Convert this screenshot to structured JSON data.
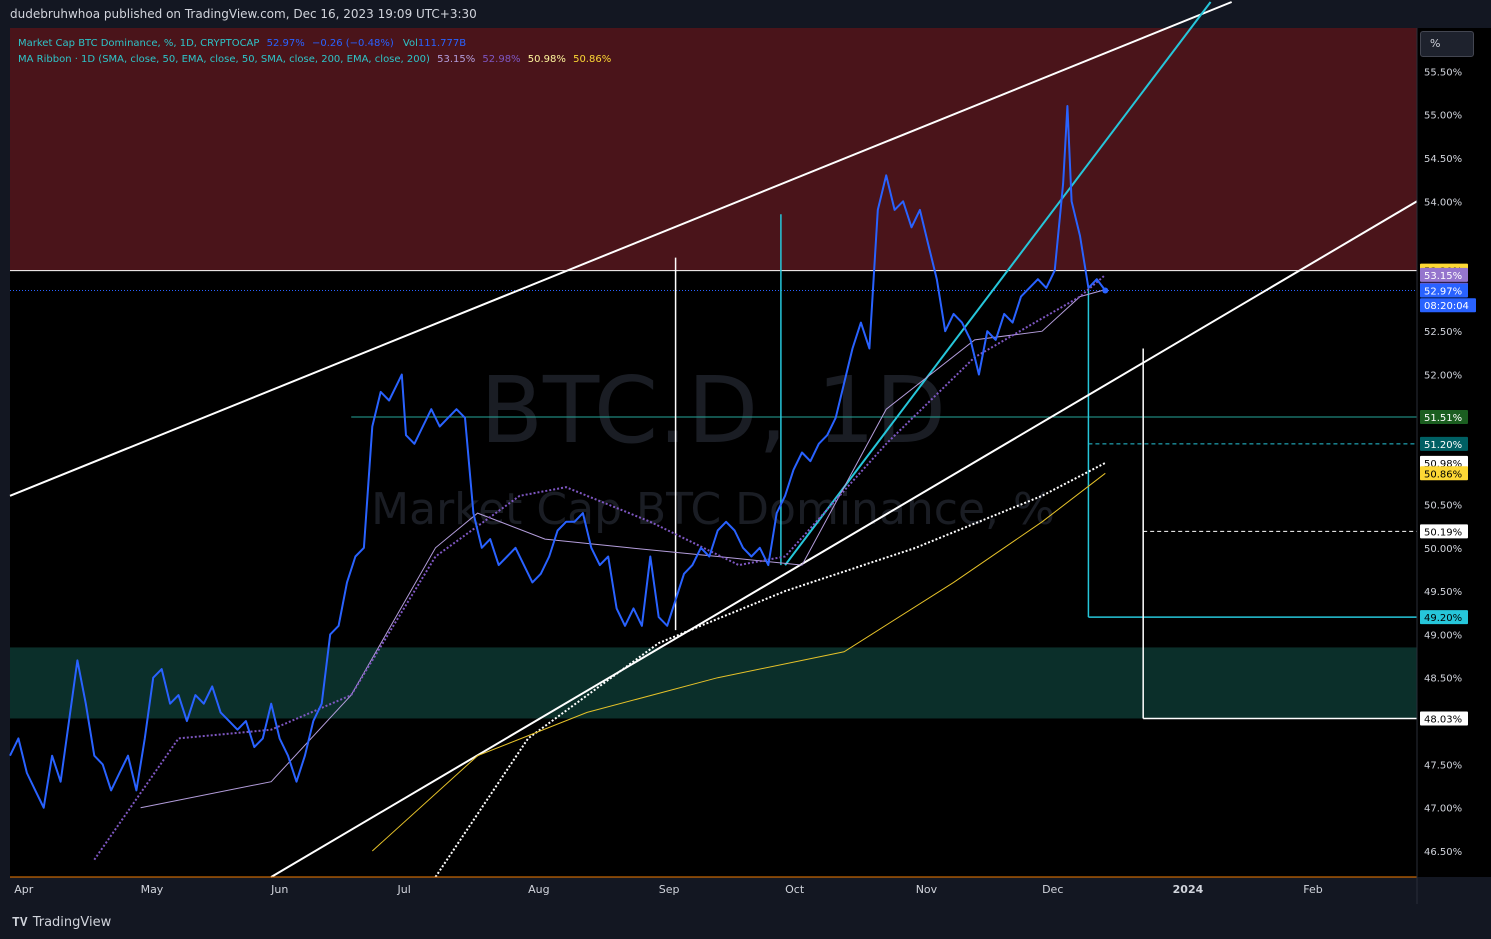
{
  "header": {
    "publisher": "dudebruhwhoa published on TradingView.com, Dec 16, 2023 19:09 UTC+3:30"
  },
  "legend": {
    "row1_name": "Market Cap BTC Dominance, %, 1D, CRYPTOCAP",
    "row1_value": "52.97%",
    "row1_change": "−0.26 (−0.48%)",
    "row1_vol_label": "Vol",
    "row1_vol_value": "111.777B",
    "row2_name": "MA Ribbon · 1D (SMA, close, 50, EMA, close, 50, SMA, close, 200, EMA, close, 200)",
    "row2_v1": "53.15%",
    "row2_v2": "52.98%",
    "row2_v3": "50.98%",
    "row2_v4": "50.86%"
  },
  "watermark": {
    "symbol": "BTC.D, 1D",
    "description": "Market Cap BTC Dominance, %"
  },
  "units_button": "%",
  "footer": {
    "brand": "TradingView"
  },
  "colors": {
    "background": "#000000",
    "resistance_zone": "#4a141a",
    "support_zone": "#0b2f2a",
    "price_line": "#2962ff",
    "sma50": "#b39ddb",
    "ema50": "#7e57c2",
    "sma200": "#ffffff",
    "ema200": "#e6c229",
    "trendline": "#ffffff",
    "cyan": "#26c6da"
  },
  "chart_data": {
    "type": "line",
    "symbol": "BTC.D",
    "interval": "1D",
    "x_range": [
      "2023-03-31",
      "2024-02-28"
    ],
    "ylim": [
      46.2,
      56.0
    ],
    "x_tick_labels": [
      {
        "label": "Apr",
        "date": "2023-04-01"
      },
      {
        "label": "May",
        "date": "2023-05-01"
      },
      {
        "label": "Jun",
        "date": "2023-06-01"
      },
      {
        "label": "Jul",
        "date": "2023-07-01"
      },
      {
        "label": "Aug",
        "date": "2023-08-01"
      },
      {
        "label": "Sep",
        "date": "2023-09-01"
      },
      {
        "label": "Oct",
        "date": "2023-10-01"
      },
      {
        "label": "Nov",
        "date": "2023-11-01"
      },
      {
        "label": "Dec",
        "date": "2023-12-01"
      },
      {
        "label": "2024",
        "date": "2024-01-01"
      },
      {
        "label": "Feb",
        "date": "2024-02-01"
      }
    ],
    "y_tick_labels": [
      "55.50%",
      "55.00%",
      "54.50%",
      "54.00%",
      "52.50%",
      "52.00%",
      "50.50%",
      "50.00%",
      "49.50%",
      "49.00%",
      "48.50%",
      "47.50%",
      "47.00%",
      "46.50%"
    ],
    "y_tick_values": [
      55.5,
      55.0,
      54.5,
      54.0,
      52.5,
      52.0,
      50.5,
      50.0,
      49.5,
      49.0,
      48.5,
      47.5,
      47.0,
      46.5
    ],
    "price_series": {
      "points": [
        [
          "2023-03-31",
          47.6
        ],
        [
          "2023-04-02",
          47.8
        ],
        [
          "2023-04-04",
          47.4
        ],
        [
          "2023-04-06",
          47.2
        ],
        [
          "2023-04-08",
          47.0
        ],
        [
          "2023-04-10",
          47.6
        ],
        [
          "2023-04-12",
          47.3
        ],
        [
          "2023-04-14",
          48.0
        ],
        [
          "2023-04-16",
          48.7
        ],
        [
          "2023-04-18",
          48.2
        ],
        [
          "2023-04-20",
          47.6
        ],
        [
          "2023-04-22",
          47.5
        ],
        [
          "2023-04-24",
          47.2
        ],
        [
          "2023-04-26",
          47.4
        ],
        [
          "2023-04-28",
          47.6
        ],
        [
          "2023-04-30",
          47.2
        ],
        [
          "2023-05-02",
          47.8
        ],
        [
          "2023-05-04",
          48.5
        ],
        [
          "2023-05-06",
          48.6
        ],
        [
          "2023-05-08",
          48.2
        ],
        [
          "2023-05-10",
          48.3
        ],
        [
          "2023-05-12",
          48.0
        ],
        [
          "2023-05-14",
          48.3
        ],
        [
          "2023-05-16",
          48.2
        ],
        [
          "2023-05-18",
          48.4
        ],
        [
          "2023-05-20",
          48.1
        ],
        [
          "2023-05-22",
          48.0
        ],
        [
          "2023-05-24",
          47.9
        ],
        [
          "2023-05-26",
          48.0
        ],
        [
          "2023-05-28",
          47.7
        ],
        [
          "2023-05-30",
          47.8
        ],
        [
          "2023-06-01",
          48.2
        ],
        [
          "2023-06-03",
          47.8
        ],
        [
          "2023-06-05",
          47.6
        ],
        [
          "2023-06-07",
          47.3
        ],
        [
          "2023-06-09",
          47.6
        ],
        [
          "2023-06-11",
          48.0
        ],
        [
          "2023-06-13",
          48.2
        ],
        [
          "2023-06-15",
          49.0
        ],
        [
          "2023-06-17",
          49.1
        ],
        [
          "2023-06-19",
          49.6
        ],
        [
          "2023-06-21",
          49.9
        ],
        [
          "2023-06-23",
          50.0
        ],
        [
          "2023-06-25",
          51.4
        ],
        [
          "2023-06-27",
          51.8
        ],
        [
          "2023-06-29",
          51.7
        ],
        [
          "2023-07-01",
          51.9
        ],
        [
          "2023-07-02",
          52.0
        ],
        [
          "2023-07-03",
          51.3
        ],
        [
          "2023-07-05",
          51.2
        ],
        [
          "2023-07-07",
          51.4
        ],
        [
          "2023-07-09",
          51.6
        ],
        [
          "2023-07-11",
          51.4
        ],
        [
          "2023-07-13",
          51.5
        ],
        [
          "2023-07-15",
          51.6
        ],
        [
          "2023-07-17",
          51.5
        ],
        [
          "2023-07-19",
          50.4
        ],
        [
          "2023-07-21",
          50.0
        ],
        [
          "2023-07-23",
          50.1
        ],
        [
          "2023-07-25",
          49.8
        ],
        [
          "2023-07-27",
          49.9
        ],
        [
          "2023-07-29",
          50.0
        ],
        [
          "2023-07-31",
          49.8
        ],
        [
          "2023-08-02",
          49.6
        ],
        [
          "2023-08-04",
          49.7
        ],
        [
          "2023-08-06",
          49.9
        ],
        [
          "2023-08-08",
          50.2
        ],
        [
          "2023-08-10",
          50.3
        ],
        [
          "2023-08-12",
          50.3
        ],
        [
          "2023-08-14",
          50.4
        ],
        [
          "2023-08-16",
          50.0
        ],
        [
          "2023-08-18",
          49.8
        ],
        [
          "2023-08-20",
          49.9
        ],
        [
          "2023-08-22",
          49.3
        ],
        [
          "2023-08-24",
          49.1
        ],
        [
          "2023-08-26",
          49.3
        ],
        [
          "2023-08-28",
          49.1
        ],
        [
          "2023-08-30",
          49.9
        ],
        [
          "2023-09-01",
          49.2
        ],
        [
          "2023-09-03",
          49.1
        ],
        [
          "2023-09-05",
          49.4
        ],
        [
          "2023-09-07",
          49.7
        ],
        [
          "2023-09-09",
          49.8
        ],
        [
          "2023-09-11",
          50.0
        ],
        [
          "2023-09-13",
          49.9
        ],
        [
          "2023-09-15",
          50.2
        ],
        [
          "2023-09-17",
          50.3
        ],
        [
          "2023-09-19",
          50.2
        ],
        [
          "2023-09-21",
          50.0
        ],
        [
          "2023-09-23",
          49.9
        ],
        [
          "2023-09-25",
          50.0
        ],
        [
          "2023-09-27",
          49.8
        ],
        [
          "2023-09-29",
          50.4
        ],
        [
          "2023-10-01",
          50.6
        ],
        [
          "2023-10-03",
          50.9
        ],
        [
          "2023-10-05",
          51.1
        ],
        [
          "2023-10-07",
          51.0
        ],
        [
          "2023-10-09",
          51.2
        ],
        [
          "2023-10-11",
          51.3
        ],
        [
          "2023-10-13",
          51.5
        ],
        [
          "2023-10-15",
          51.9
        ],
        [
          "2023-10-17",
          52.3
        ],
        [
          "2023-10-19",
          52.6
        ],
        [
          "2023-10-21",
          52.3
        ],
        [
          "2023-10-23",
          53.9
        ],
        [
          "2023-10-25",
          54.3
        ],
        [
          "2023-10-27",
          53.9
        ],
        [
          "2023-10-29",
          54.0
        ],
        [
          "2023-10-31",
          53.7
        ],
        [
          "2023-11-02",
          53.9
        ],
        [
          "2023-11-04",
          53.5
        ],
        [
          "2023-11-06",
          53.1
        ],
        [
          "2023-11-08",
          52.5
        ],
        [
          "2023-11-10",
          52.7
        ],
        [
          "2023-11-12",
          52.6
        ],
        [
          "2023-11-14",
          52.4
        ],
        [
          "2023-11-16",
          52.0
        ],
        [
          "2023-11-18",
          52.5
        ],
        [
          "2023-11-20",
          52.4
        ],
        [
          "2023-11-22",
          52.7
        ],
        [
          "2023-11-24",
          52.6
        ],
        [
          "2023-11-26",
          52.9
        ],
        [
          "2023-11-28",
          53.0
        ],
        [
          "2023-11-30",
          53.1
        ],
        [
          "2023-12-02",
          53.0
        ],
        [
          "2023-12-04",
          53.2
        ],
        [
          "2023-12-06",
          54.2
        ],
        [
          "2023-12-07",
          55.1
        ],
        [
          "2023-12-08",
          54.0
        ],
        [
          "2023-12-10",
          53.6
        ],
        [
          "2023-12-12",
          53.0
        ],
        [
          "2023-12-14",
          53.1
        ],
        [
          "2023-12-16",
          52.97
        ]
      ]
    },
    "ma_ribbon": [
      {
        "name": "SMA 50",
        "type": "SMA",
        "length": 50,
        "style": "solid",
        "color": "#b39ddb",
        "points": [
          [
            "2023-05-01",
            47.0
          ],
          [
            "2023-06-01",
            47.3
          ],
          [
            "2023-06-20",
            48.3
          ],
          [
            "2023-07-10",
            50.0
          ],
          [
            "2023-07-20",
            50.4
          ],
          [
            "2023-08-05",
            50.1
          ],
          [
            "2023-08-25",
            50.0
          ],
          [
            "2023-09-15",
            49.9
          ],
          [
            "2023-10-05",
            49.8
          ],
          [
            "2023-10-25",
            51.6
          ],
          [
            "2023-11-15",
            52.4
          ],
          [
            "2023-12-01",
            52.5
          ],
          [
            "2023-12-10",
            52.9
          ],
          [
            "2023-12-16",
            52.98
          ]
        ]
      },
      {
        "name": "EMA 50",
        "type": "EMA",
        "length": 50,
        "style": "dotted",
        "color": "#7e57c2",
        "points": [
          [
            "2023-04-20",
            46.4
          ],
          [
            "2023-05-10",
            47.8
          ],
          [
            "2023-06-01",
            47.9
          ],
          [
            "2023-06-20",
            48.3
          ],
          [
            "2023-07-10",
            49.9
          ],
          [
            "2023-07-30",
            50.6
          ],
          [
            "2023-08-10",
            50.7
          ],
          [
            "2023-08-30",
            50.3
          ],
          [
            "2023-09-20",
            49.8
          ],
          [
            "2023-10-01",
            49.9
          ],
          [
            "2023-10-25",
            51.2
          ],
          [
            "2023-11-15",
            52.2
          ],
          [
            "2023-12-10",
            52.9
          ],
          [
            "2023-12-16",
            53.15
          ]
        ]
      },
      {
        "name": "SMA 200",
        "type": "SMA",
        "length": 200,
        "style": "dotted",
        "color": "#ffffff",
        "points": [
          [
            "2023-07-10",
            46.2
          ],
          [
            "2023-08-01",
            47.8
          ],
          [
            "2023-09-01",
            48.9
          ],
          [
            "2023-10-01",
            49.5
          ],
          [
            "2023-11-01",
            50.0
          ],
          [
            "2023-12-01",
            50.6
          ],
          [
            "2023-12-16",
            50.98
          ]
        ]
      },
      {
        "name": "EMA 200",
        "type": "EMA",
        "length": 200,
        "style": "solid",
        "color": "#e6c229",
        "points": [
          [
            "2023-06-25",
            46.5
          ],
          [
            "2023-07-20",
            47.6
          ],
          [
            "2023-08-15",
            48.1
          ],
          [
            "2023-09-15",
            48.5
          ],
          [
            "2023-10-15",
            48.8
          ],
          [
            "2023-11-10",
            49.6
          ],
          [
            "2023-12-01",
            50.3
          ],
          [
            "2023-12-16",
            50.86
          ]
        ]
      }
    ],
    "price_scale_labels": [
      {
        "text": "53.20%",
        "value": 53.2,
        "color": "#fdd835",
        "text_color": "#000000"
      },
      {
        "text": "53.15%",
        "value": 53.15,
        "color": "#9575cd",
        "text_color": "#ffffff"
      },
      {
        "text": "52.98%",
        "value": 52.98,
        "color": "#7e57c2",
        "text_color": "#ffffff"
      },
      {
        "text": "52.97%",
        "value": 52.97,
        "color": "#2962ff",
        "text_color": "#ffffff"
      },
      {
        "text": "08:20:04",
        "value": 52.8,
        "color": "#2962ff",
        "text_color": "#ffffff"
      },
      {
        "text": "51.51%",
        "value": 51.51,
        "color": "#1b5e20",
        "text_color": "#ffffff"
      },
      {
        "text": "51.20%",
        "value": 51.2,
        "color": "#006064",
        "text_color": "#ffffff"
      },
      {
        "text": "50.98%",
        "value": 50.98,
        "color": "#ffffff",
        "text_color": "#000000"
      },
      {
        "text": "50.86%",
        "value": 50.86,
        "color": "#fdd835",
        "text_color": "#000000"
      },
      {
        "text": "50.19%",
        "value": 50.19,
        "color": "#ffffff",
        "text_color": "#000000"
      },
      {
        "text": "49.20%",
        "value": 49.2,
        "color": "#26c6da",
        "text_color": "#000000"
      },
      {
        "text": "48.03%",
        "value": 48.03,
        "color": "#ffffff",
        "text_color": "#000000"
      }
    ],
    "zones": [
      {
        "name": "resistance",
        "from": 53.2,
        "to": 56.0,
        "color": "#4a141a"
      },
      {
        "name": "support",
        "from": 48.03,
        "to": 48.85,
        "color": "#0b2f2a"
      }
    ],
    "horizontal_lines": [
      {
        "name": "resistance-level",
        "value": 53.2,
        "color": "#ffffff",
        "style": "solid"
      },
      {
        "name": "level-51-51",
        "value": 51.51,
        "color": "#26a69a",
        "style": "solid",
        "from": "2023-06-20"
      },
      {
        "name": "current-price",
        "value": 52.97,
        "color": "#2962ff",
        "style": "dotted"
      }
    ],
    "trendlines": [
      {
        "name": "channel-upper",
        "color": "#ffffff",
        "from": [
          "2023-03-31",
          50.6
        ],
        "to": [
          "2024-01-15",
          56.3
        ]
      },
      {
        "name": "channel-lower",
        "color": "#ffffff",
        "from": [
          "2023-06-01",
          46.2
        ],
        "to": [
          "2024-02-28",
          54.0
        ]
      },
      {
        "name": "cyan-rising",
        "color": "#26c6da",
        "from": [
          "2023-10-01",
          49.8
        ],
        "to": [
          "2024-01-10",
          56.3
        ]
      }
    ],
    "measure_lines": [
      {
        "name": "measure-sep",
        "color": "#ffffff",
        "date": "2023-09-05",
        "from": 49.05,
        "to": 53.35
      },
      {
        "name": "measure-oct",
        "color": "#26c6da",
        "date": "2023-09-30",
        "from": 49.8,
        "to": 53.85
      },
      {
        "name": "target-cyan",
        "color": "#26c6da",
        "date": "2023-12-12",
        "from": 49.2,
        "to": 53.0,
        "target": 49.2,
        "dashed_level": 51.2
      },
      {
        "name": "target-white",
        "color": "#ffffff",
        "date": "2023-12-25",
        "from": 48.03,
        "to": 52.3,
        "target": 48.03,
        "dashed_level": 50.19
      }
    ]
  }
}
